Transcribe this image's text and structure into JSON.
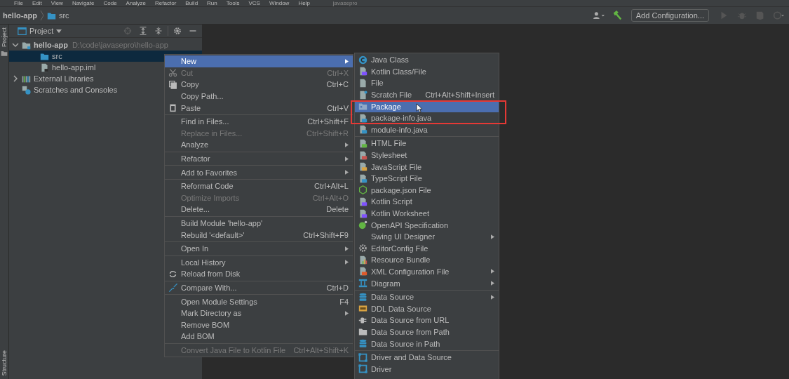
{
  "menu_bar": [
    "File",
    "Edit",
    "View",
    "Navigate",
    "Code",
    "Analyze",
    "Refactor",
    "Build",
    "Run",
    "Tools",
    "VCS",
    "Window",
    "Help"
  ],
  "menu_bar_title": "javasepro",
  "nav_bar": {
    "project": "hello-app",
    "folder": "src"
  },
  "toolbar": {
    "run_config": "Add Configuration..."
  },
  "tool_strip": {
    "top": "Project",
    "bottom": "Structure"
  },
  "project_panel": {
    "title": "Project",
    "tree": [
      {
        "label": "hello-app",
        "path": "D:\\code\\javasepro\\hello-app",
        "kind": "module",
        "expanded": true,
        "selected": false,
        "children": [
          {
            "label": "src",
            "kind": "folder",
            "selected": true
          },
          {
            "label": "hello-app.iml",
            "kind": "file",
            "selected": false
          }
        ]
      },
      {
        "label": "External Libraries",
        "kind": "library",
        "expanded": false,
        "selected": false
      },
      {
        "label": "Scratches and Consoles",
        "kind": "scratches",
        "selected": false
      }
    ]
  },
  "context_menu": {
    "groups": [
      [
        {
          "label": "New",
          "submenu": true,
          "selected": true,
          "disabled": false
        },
        {
          "label": "Cut",
          "shortcut": "Ctrl+X",
          "selected": false,
          "disabled": true
        },
        {
          "label": "Copy",
          "shortcut": "Ctrl+C",
          "selected": false,
          "disabled": false
        },
        {
          "label": "Copy Path...",
          "selected": false,
          "disabled": false
        },
        {
          "label": "Paste",
          "shortcut": "Ctrl+V",
          "selected": false,
          "disabled": false
        }
      ],
      [
        {
          "label": "Find in Files...",
          "shortcut": "Ctrl+Shift+F",
          "selected": false,
          "disabled": false
        },
        {
          "label": "Replace in Files...",
          "shortcut": "Ctrl+Shift+R",
          "selected": false,
          "disabled": true
        },
        {
          "label": "Analyze",
          "submenu": true,
          "selected": false,
          "disabled": false
        }
      ],
      [
        {
          "label": "Refactor",
          "submenu": true,
          "selected": false,
          "disabled": false
        }
      ],
      [
        {
          "label": "Add to Favorites",
          "submenu": true,
          "selected": false,
          "disabled": false
        }
      ],
      [
        {
          "label": "Reformat Code",
          "shortcut": "Ctrl+Alt+L",
          "selected": false,
          "disabled": false
        },
        {
          "label": "Optimize Imports",
          "shortcut": "Ctrl+Alt+O",
          "selected": false,
          "disabled": true
        },
        {
          "label": "Delete...",
          "shortcut": "Delete",
          "selected": false,
          "disabled": false
        }
      ],
      [
        {
          "label": "Build Module 'hello-app'",
          "selected": false,
          "disabled": false
        },
        {
          "label": "Rebuild '<default>'",
          "shortcut": "Ctrl+Shift+F9",
          "selected": false,
          "disabled": false
        }
      ],
      [
        {
          "label": "Open In",
          "submenu": true,
          "selected": false,
          "disabled": false
        }
      ],
      [
        {
          "label": "Local History",
          "submenu": true,
          "selected": false,
          "disabled": false
        },
        {
          "label": "Reload from Disk",
          "selected": false,
          "disabled": false
        }
      ],
      [
        {
          "label": "Compare With...",
          "shortcut": "Ctrl+D",
          "selected": false,
          "disabled": false
        }
      ],
      [
        {
          "label": "Open Module Settings",
          "shortcut": "F4",
          "selected": false,
          "disabled": false
        },
        {
          "label": "Mark Directory as",
          "submenu": true,
          "selected": false,
          "disabled": false
        },
        {
          "label": "Remove BOM",
          "selected": false,
          "disabled": false
        },
        {
          "label": "Add BOM",
          "selected": false,
          "disabled": false
        }
      ],
      [
        {
          "label": "Convert Java File to Kotlin File",
          "shortcut": "Ctrl+Alt+Shift+K",
          "selected": false,
          "disabled": true
        }
      ]
    ]
  },
  "new_submenu": {
    "groups": [
      [
        {
          "label": "Java Class",
          "selected": false
        },
        {
          "label": "Kotlin Class/File",
          "selected": false
        },
        {
          "label": "File",
          "selected": false
        },
        {
          "label": "Scratch File",
          "shortcut": "Ctrl+Alt+Shift+Insert",
          "selected": false
        },
        {
          "label": "Package",
          "selected": true
        },
        {
          "label": "package-info.java",
          "selected": false
        },
        {
          "label": "module-info.java",
          "selected": false
        }
      ],
      [
        {
          "label": "HTML File",
          "selected": false
        },
        {
          "label": "Stylesheet",
          "selected": false
        },
        {
          "label": "JavaScript File",
          "selected": false
        },
        {
          "label": "TypeScript File",
          "selected": false
        },
        {
          "label": "package.json File",
          "selected": false
        },
        {
          "label": "Kotlin Script",
          "selected": false
        },
        {
          "label": "Kotlin Worksheet",
          "selected": false
        },
        {
          "label": "OpenAPI Specification",
          "selected": false
        },
        {
          "label": "Swing UI Designer",
          "submenu": true,
          "selected": false
        },
        {
          "label": "EditorConfig File",
          "selected": false
        },
        {
          "label": "Resource Bundle",
          "selected": false
        },
        {
          "label": "XML Configuration File",
          "submenu": true,
          "selected": false
        },
        {
          "label": "Diagram",
          "submenu": true,
          "selected": false
        }
      ],
      [
        {
          "label": "Data Source",
          "submenu": true,
          "selected": false
        },
        {
          "label": "DDL Data Source",
          "selected": false
        },
        {
          "label": "Data Source from URL",
          "selected": false
        },
        {
          "label": "Data Source from Path",
          "selected": false
        },
        {
          "label": "Data Source in Path",
          "selected": false
        }
      ],
      [
        {
          "label": "Driver and Data Source",
          "selected": false
        },
        {
          "label": "Driver",
          "selected": false
        }
      ]
    ]
  }
}
